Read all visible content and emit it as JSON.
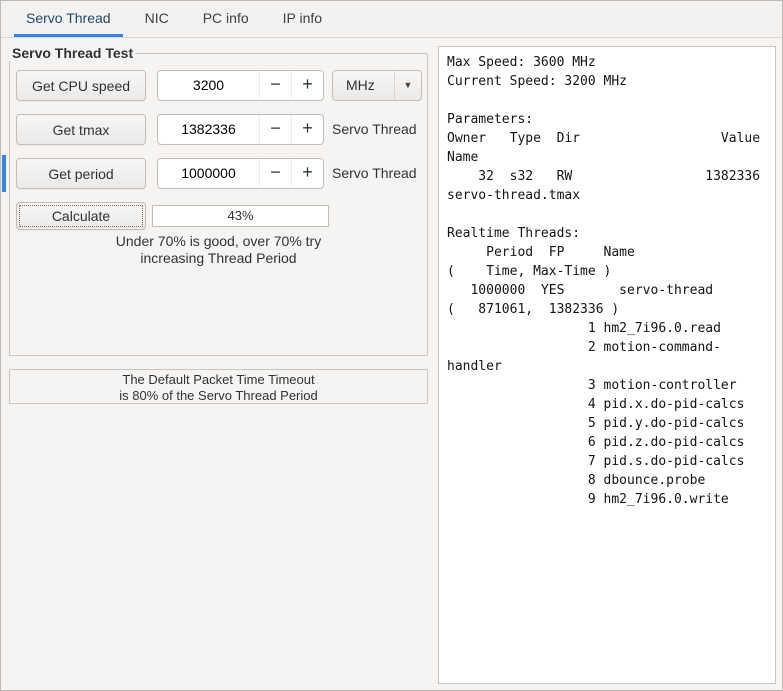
{
  "colors": {
    "accent": "#3584e4"
  },
  "tabs": [
    {
      "label": "Servo Thread"
    },
    {
      "label": "NIC"
    },
    {
      "label": "PC info"
    },
    {
      "label": "IP info"
    }
  ],
  "servo_test": {
    "frame_title": "Servo Thread Test",
    "rows": [
      {
        "button": "Get CPU speed",
        "value": "3200"
      },
      {
        "button": "Get tmax",
        "value": "1382336",
        "label": "Servo Thread"
      },
      {
        "button": "Get period",
        "value": "1000000",
        "label": "Servo Thread"
      }
    ],
    "unit_value": "MHz",
    "calculate_button": "Calculate",
    "result_value": "43%",
    "hint": "Under 70% is good, over 70% try\nincreasing Thread Period"
  },
  "timeout_note": "The Default Packet Time Timeout\nis 80% of the Servo Thread Period",
  "icons": {
    "minus": "−",
    "plus": "+",
    "dropdown": "▼"
  },
  "output_text": "Max Speed: 3600 MHz\nCurrent Speed: 3200 MHz\n\nParameters:\nOwner   Type  Dir                  Value\nName\n    32  s32   RW                 1382336\nservo-thread.tmax\n\nRealtime Threads:\n     Period  FP     Name\n(    Time, Max-Time )\n   1000000  YES       servo-thread\n(   871061,  1382336 )\n                  1 hm2_7i96.0.read\n                  2 motion-command-\nhandler\n                  3 motion-controller\n                  4 pid.x.do-pid-calcs\n                  5 pid.y.do-pid-calcs\n                  6 pid.z.do-pid-calcs\n                  7 pid.s.do-pid-calcs\n                  8 dbounce.probe\n                  9 hm2_7i96.0.write"
}
